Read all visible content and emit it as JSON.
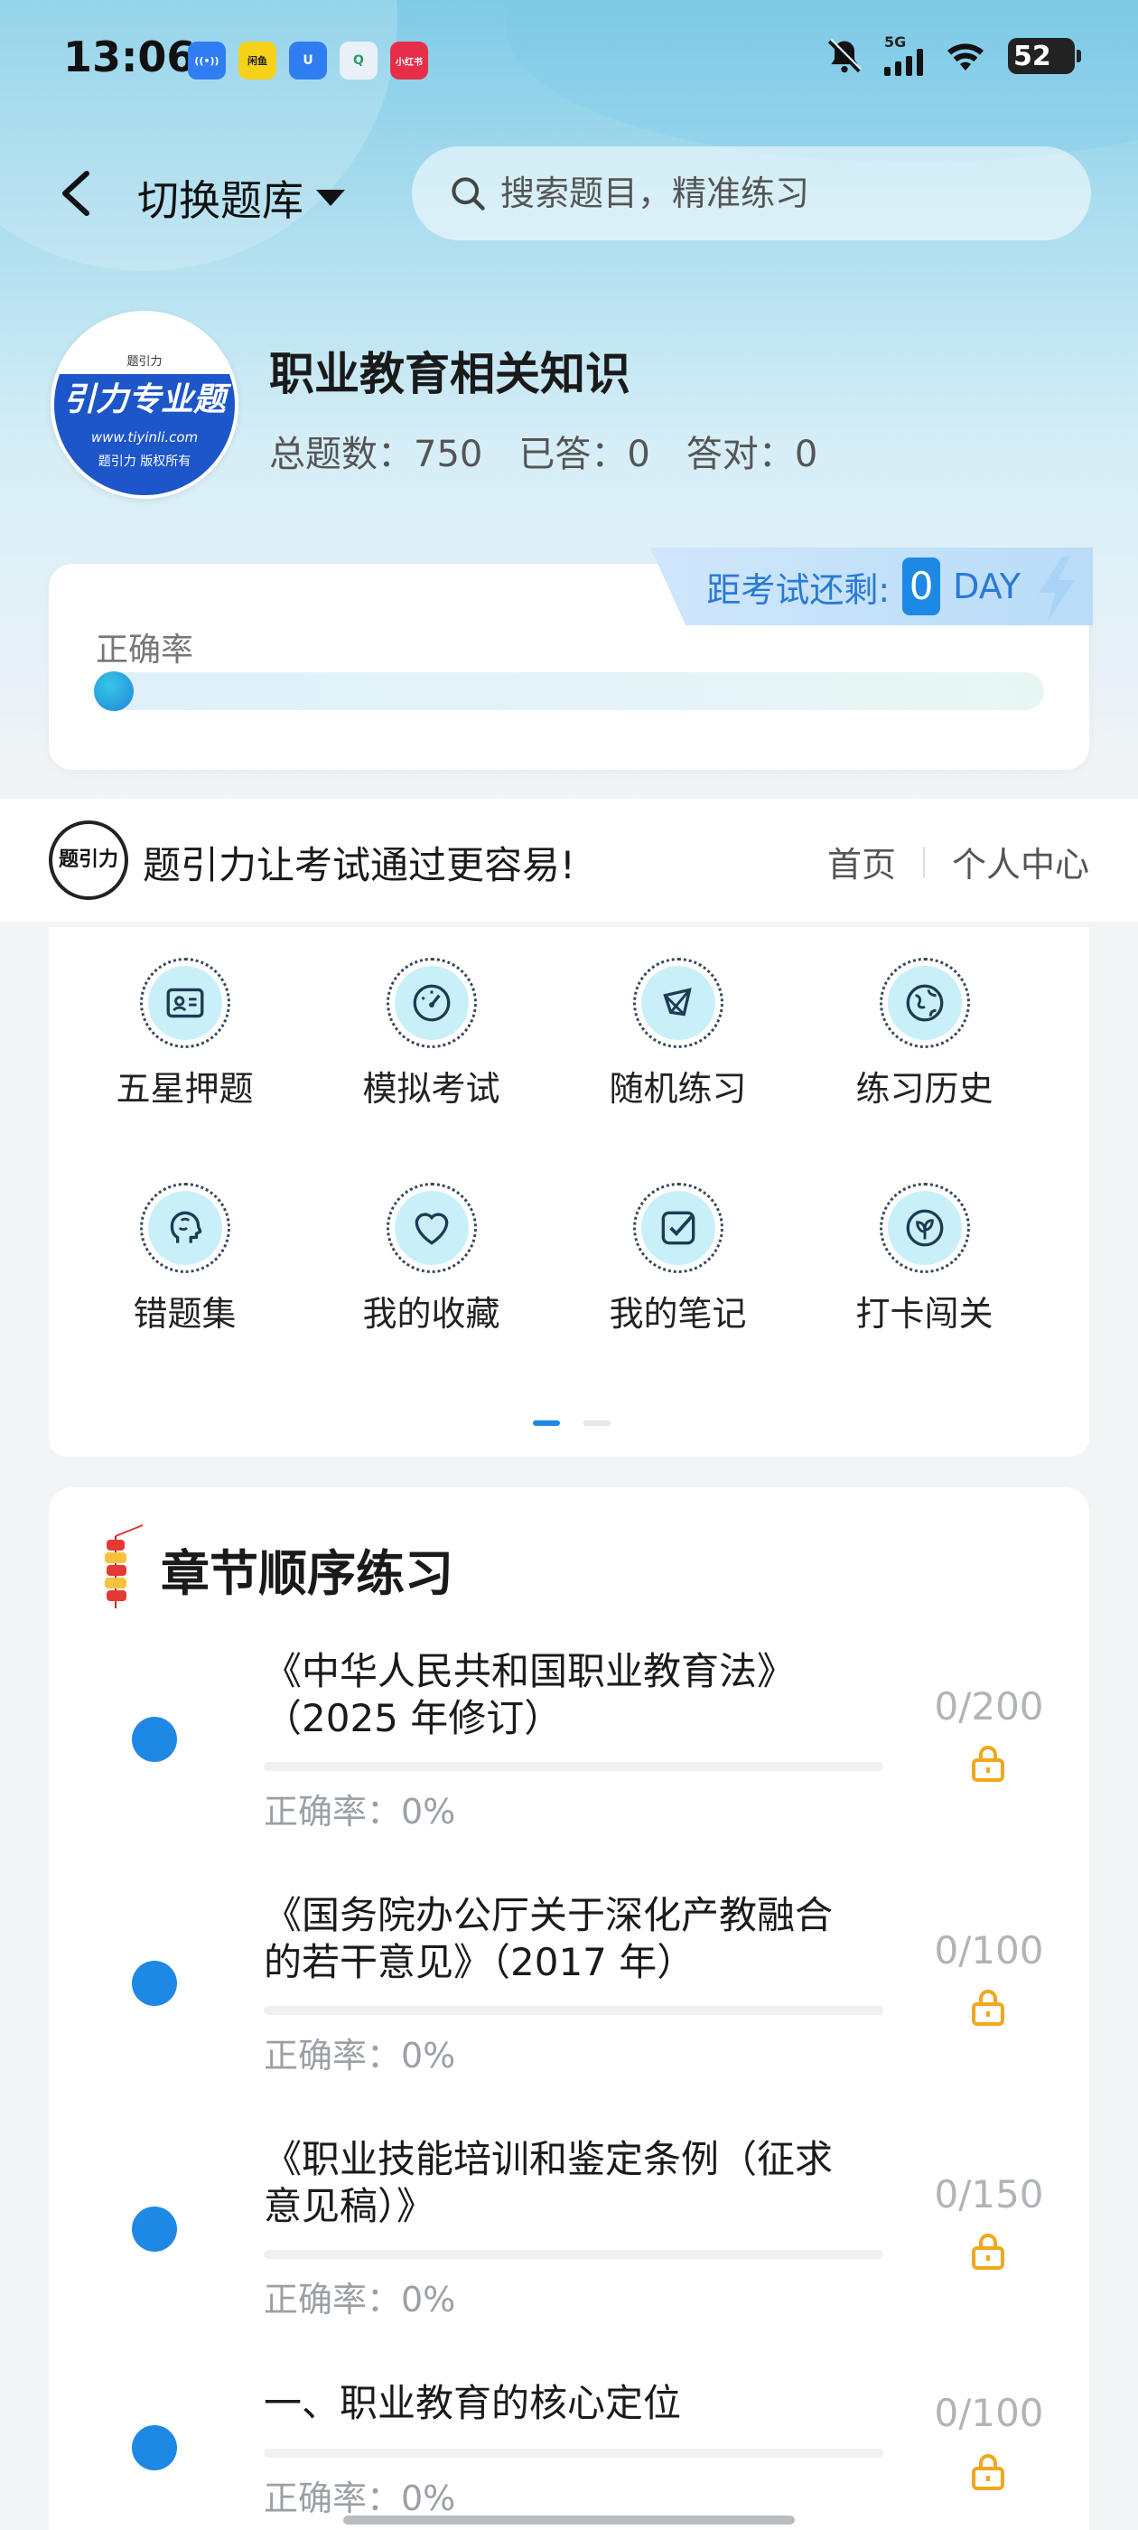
{
  "status_bar": {
    "time": "13:06",
    "network": "5G",
    "battery": "52",
    "apps": [
      {
        "name": "hotspot-icon",
        "text": "((•))",
        "color": "#2f7df0"
      },
      {
        "name": "news-app-icon",
        "text": "闲鱼",
        "color": "#f7d21b"
      },
      {
        "name": "shield-app-icon",
        "text": "U",
        "color": "#2f7df0"
      },
      {
        "name": "search-app-icon",
        "text": "Q",
        "color": "#e9f1f8"
      },
      {
        "name": "xiaohongshu-icon",
        "text": "小红书",
        "color": "#e62e4a"
      }
    ]
  },
  "nav": {
    "switch_label": "切换题库",
    "search_placeholder": "搜索题目，精准练习"
  },
  "bank": {
    "title": "职业教育相关知识",
    "total_label": "总题数：",
    "total": "750",
    "answered_label": "已答：",
    "answered": "0",
    "correct_label": "答对：",
    "correct": "0",
    "logo": {
      "brand_small": "题引力",
      "headline": "引力专业题",
      "url": "www.tiyinli.com",
      "copyright": "题引力 版权所有"
    }
  },
  "accuracy": {
    "label": "正确率",
    "value": 0,
    "countdown_label": "距考试还剩:",
    "countdown_value": "0",
    "countdown_unit": "DAY"
  },
  "banner": {
    "logo_text": "题引力",
    "slogan": "题引力让考试通过更容易!",
    "links": [
      "首页",
      "个人中心"
    ]
  },
  "functions": [
    {
      "label": "五星押题",
      "icon": "id-card-icon"
    },
    {
      "label": "模拟考试",
      "icon": "gauge-icon"
    },
    {
      "label": "随机练习",
      "icon": "shuffle-icon"
    },
    {
      "label": "练习历史",
      "icon": "globe-icon"
    },
    {
      "label": "错题集",
      "icon": "brain-icon"
    },
    {
      "label": "我的收藏",
      "icon": "heart-icon"
    },
    {
      "label": "我的笔记",
      "icon": "note-check-icon"
    },
    {
      "label": "打卡闯关",
      "icon": "leaf-icon"
    }
  ],
  "pager": {
    "pages": 2,
    "active": 0
  },
  "chapters": {
    "heading": "章节顺序练习",
    "items": [
      {
        "lines": [
          "《中华人民共和国职业教育法》",
          "（2025 年修订）"
        ],
        "rate": "正确率：0%",
        "count": "0/200",
        "progress": 0
      },
      {
        "lines": [
          "《国务院办公厅关于深化产教融合",
          "的若干意见》（2017 年）"
        ],
        "rate": "正确率：0%",
        "count": "0/100",
        "progress": 0
      },
      {
        "lines": [
          "《职业技能培训和鉴定条例（征求",
          "意见稿）》"
        ],
        "rate": "正确率：0%",
        "count": "0/150",
        "progress": 0
      },
      {
        "lines": [
          "一、职业教育的核心定位"
        ],
        "rate": "正确率：0%",
        "count": "0/100",
        "progress": 0
      }
    ]
  },
  "colors": {
    "accent": "#1e88e5",
    "icon_bg": "#c9f0f8",
    "lock": "#f0a81c"
  }
}
